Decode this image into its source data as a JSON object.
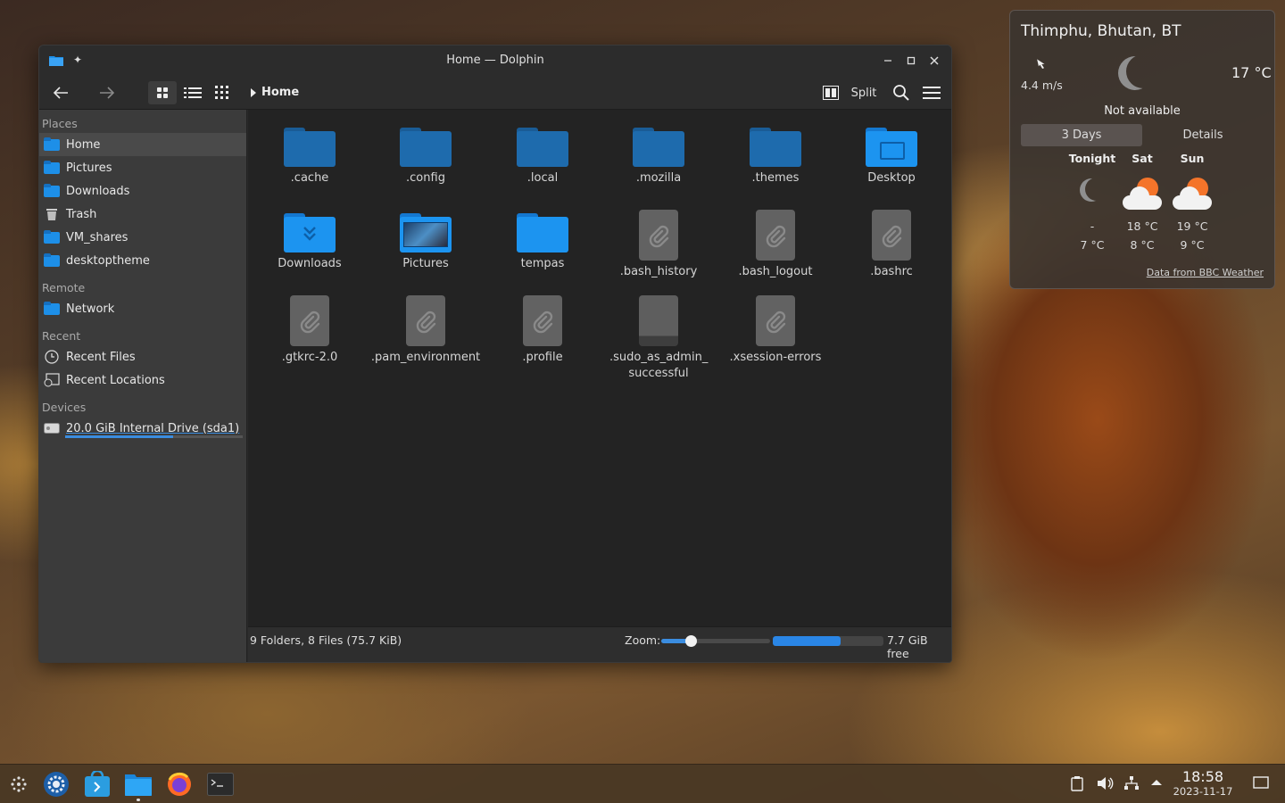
{
  "window": {
    "title": "Home — Dolphin",
    "breadcrumb": "Home",
    "split_label": "Split"
  },
  "sidebar": {
    "places_header": "Places",
    "places": [
      {
        "label": "Home",
        "icon": "home-folder-icon"
      },
      {
        "label": "Pictures",
        "icon": "pictures-folder-icon"
      },
      {
        "label": "Downloads",
        "icon": "downloads-folder-icon"
      },
      {
        "label": "Trash",
        "icon": "trash-icon"
      },
      {
        "label": "VM_shares",
        "icon": "folder-icon"
      },
      {
        "label": "desktoptheme",
        "icon": "folder-icon"
      }
    ],
    "remote_header": "Remote",
    "remote": [
      {
        "label": "Network",
        "icon": "network-folder-icon"
      }
    ],
    "recent_header": "Recent",
    "recent": [
      {
        "label": "Recent Files",
        "icon": "clock-icon"
      },
      {
        "label": "Recent Locations",
        "icon": "recent-locations-icon"
      }
    ],
    "devices_header": "Devices",
    "devices": [
      {
        "label": "20.0 GiB Internal Drive (sda1)",
        "icon": "drive-icon",
        "used_fraction": 0.61
      }
    ]
  },
  "files": [
    {
      "name": ".cache",
      "kind": "folder-hidden"
    },
    {
      "name": ".config",
      "kind": "folder-hidden"
    },
    {
      "name": ".local",
      "kind": "folder-hidden"
    },
    {
      "name": ".mozilla",
      "kind": "folder-hidden"
    },
    {
      "name": ".themes",
      "kind": "folder-hidden"
    },
    {
      "name": "Desktop",
      "kind": "folder-desktop"
    },
    {
      "name": "Downloads",
      "kind": "folder-downloads"
    },
    {
      "name": "Pictures",
      "kind": "folder-pictures"
    },
    {
      "name": "tempas",
      "kind": "folder"
    },
    {
      "name": ".bash_history",
      "kind": "file"
    },
    {
      "name": ".bash_logout",
      "kind": "file"
    },
    {
      "name": ".bashrc",
      "kind": "file"
    },
    {
      "name": ".gtkrc-2.0",
      "kind": "file"
    },
    {
      "name": ".pam_environment",
      "kind": "file"
    },
    {
      "name": ".profile",
      "kind": "file"
    },
    {
      "name": ".sudo_as_admin_ successful",
      "kind": "file-empty"
    },
    {
      "name": ".xsession-errors",
      "kind": "file"
    }
  ],
  "statusbar": {
    "summary": "9 Folders, 8 Files (75.7 KiB)",
    "zoom_label": "Zoom:",
    "zoom_fraction": 0.27,
    "free_space": "7.7 GiB free",
    "used_fraction": 0.61
  },
  "weather": {
    "location": "Thimphu, Bhutan, BT",
    "wind": "4.4 m/s",
    "current_temp": "17 °C",
    "condition": "Not available",
    "tabs": [
      "3 Days",
      "Details"
    ],
    "forecast": [
      {
        "day": "Tonight",
        "icon": "moon-icon",
        "high": "-",
        "low": "7 °C"
      },
      {
        "day": "Sat",
        "icon": "partly-cloudy-icon",
        "high": "18 °C",
        "low": "8 °C"
      },
      {
        "day": "Sun",
        "icon": "partly-cloudy-icon",
        "high": "19 °C",
        "low": "9 °C"
      }
    ],
    "source": "Data from BBC Weather"
  },
  "taskbar": {
    "apps": [
      "app-launcher-icon",
      "system-settings-icon",
      "discover-icon",
      "dolphin-icon",
      "firefox-icon",
      "konsole-icon"
    ],
    "time": "18:58",
    "date": "2023-11-17"
  }
}
